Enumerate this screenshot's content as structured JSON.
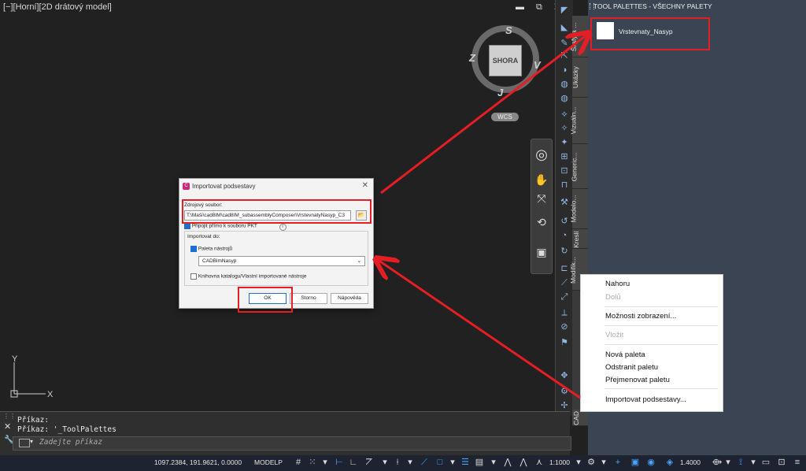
{
  "viewport": {
    "label": "[−][Horní][2D drátový model]",
    "viewcube": {
      "face": "SHORA",
      "north": "S",
      "east": "V",
      "south": "J",
      "west": "Z",
      "wcs": "WCS"
    }
  },
  "ucs": {
    "y": "Y",
    "x": "X"
  },
  "dialog": {
    "title": "Importovat podsestavy",
    "source_label": "Zdrojový soubor:",
    "source_value": "T:\\Maši\\cad8IM\\cad8IM_subassemblyComposer\\VrstevnatyNasyp_C3",
    "link_label": "Připojit přímo k souboru PKT",
    "import_to_label": "Importovat do:",
    "tool_palette_label": "Paleta nástrojů",
    "tool_palette_value": "CADBimNasyp",
    "catalog_label": "Knihovna katalogu/Vlastní importované nástroje",
    "ok": "OK",
    "cancel": "Storno",
    "help": "Nápověda"
  },
  "palettes": {
    "header": "TOOL PALETTES - VŠECHNY PALETY",
    "item": "Vrstevnaty_Nasyp",
    "tabs": [
      "Šrafy a ...",
      "Ukázky",
      "Vizuáln...",
      "Generic...",
      "Modelo...",
      "Kreslí",
      "Modifik...",
      "CAD"
    ]
  },
  "context_menu": {
    "items": [
      {
        "label": "Nahoru",
        "disabled": false
      },
      {
        "label": "Dolů",
        "disabled": true
      },
      {
        "label": "Možnosti zobrazení...",
        "disabled": false
      },
      {
        "label": "Vložit",
        "disabled": true
      },
      {
        "label": "Nová paleta",
        "disabled": false
      },
      {
        "label": "Odstranit paletu",
        "disabled": false
      },
      {
        "label": "Přejmenovat paletu",
        "disabled": false
      },
      {
        "label": "Importovat podsestavy...",
        "disabled": false
      }
    ]
  },
  "command": {
    "history": [
      "Příkaz:",
      "Příkaz: '_ToolPalettes"
    ],
    "placeholder": "Zadejte příkaz"
  },
  "status": {
    "coords": "1097.2384, 191.9621, 0.0000",
    "model": "MODELP",
    "scale": "1:1000",
    "lineweight": "1.4000"
  }
}
